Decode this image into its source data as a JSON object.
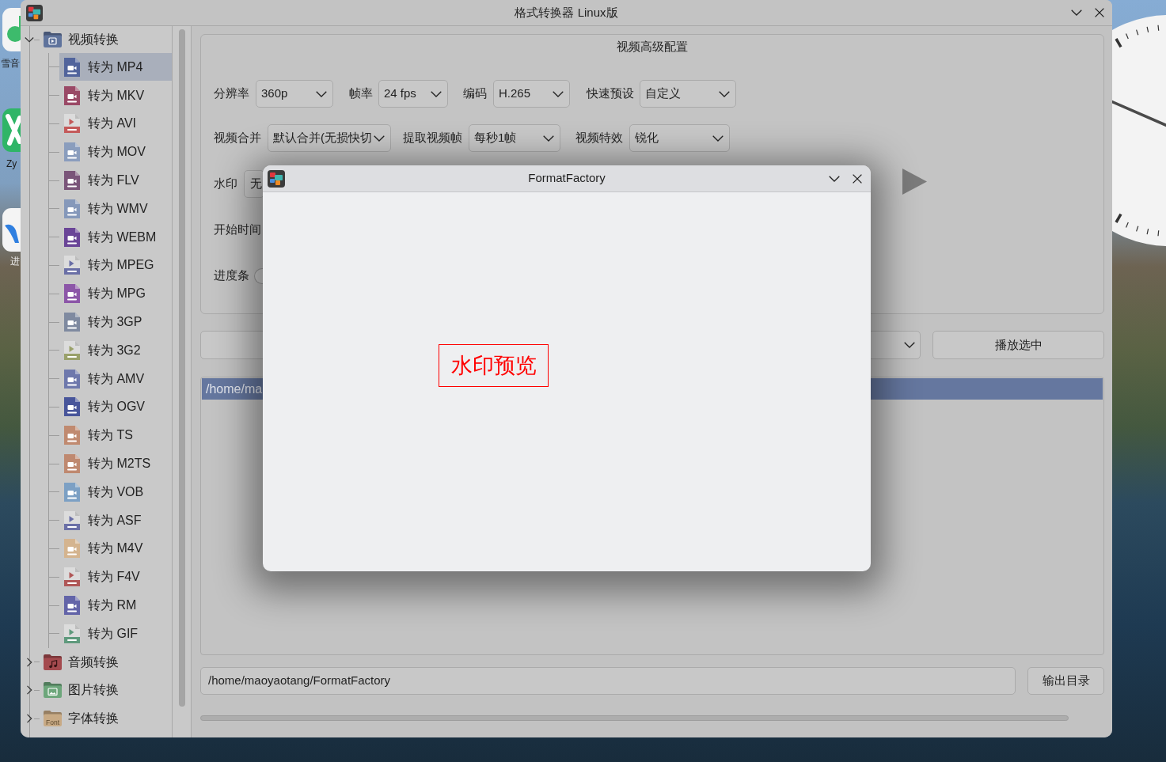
{
  "desktop": {
    "icons": [
      {
        "label": "雪音"
      },
      {
        "label": "Zy"
      },
      {
        "label": "进"
      }
    ]
  },
  "window": {
    "title": "格式转换器 Linux版"
  },
  "sidebar": {
    "items": [
      {
        "label": "视频转换",
        "kind": "video",
        "color": "#5f739c",
        "expanded": true,
        "children": [
          {
            "label": "转为 MP4",
            "kind": "solid",
            "color": "#51649c",
            "selected": true
          },
          {
            "label": "转为 MKV",
            "kind": "solid",
            "color": "#9a4966",
            "selected": false
          },
          {
            "label": "转为 AVI",
            "kind": "light",
            "color": "#c45a5a",
            "selected": false
          },
          {
            "label": "转为 MOV",
            "kind": "solid",
            "color": "#8a9dbd",
            "selected": false
          },
          {
            "label": "转为 FLV",
            "kind": "solid",
            "color": "#7a5579",
            "selected": false
          },
          {
            "label": "转为 WMV",
            "kind": "solid",
            "color": "#8598ba",
            "selected": false
          },
          {
            "label": "转为 WEBM",
            "kind": "solid",
            "color": "#6a4597",
            "selected": false
          },
          {
            "label": "转为 MPEG",
            "kind": "light",
            "color": "#6a6fa6",
            "selected": false
          },
          {
            "label": "转为 MPG",
            "kind": "solid",
            "color": "#8c56a8",
            "selected": false
          },
          {
            "label": "转为 3GP",
            "kind": "solid",
            "color": "#7f8aa0",
            "selected": false
          },
          {
            "label": "转为 3G2",
            "kind": "light",
            "color": "#9aa16b",
            "selected": false
          },
          {
            "label": "转为 AMV",
            "kind": "solid",
            "color": "#6e78ac",
            "selected": false
          },
          {
            "label": "转为 OGV",
            "kind": "solid",
            "color": "#48559a",
            "selected": false
          },
          {
            "label": "转为 TS",
            "kind": "solid",
            "color": "#c08a70",
            "selected": false
          },
          {
            "label": "转为 M2TS",
            "kind": "solid",
            "color": "#bf8970",
            "selected": false
          },
          {
            "label": "转为 VOB",
            "kind": "solid",
            "color": "#7ca0c4",
            "selected": false
          },
          {
            "label": "转为 ASF",
            "kind": "light",
            "color": "#6b70a7",
            "selected": false
          },
          {
            "label": "转为 M4V",
            "kind": "solid",
            "color": "#d4b48f",
            "selected": false
          },
          {
            "label": "转为 F4V",
            "kind": "light",
            "color": "#b05858",
            "selected": false
          },
          {
            "label": "转为 RM",
            "kind": "solid",
            "color": "#6364a8",
            "selected": false
          },
          {
            "label": "转为 GIF",
            "kind": "light",
            "color": "#5f9a7d",
            "selected": false
          }
        ]
      },
      {
        "label": "音频转换",
        "kind": "audio",
        "color": "#a44a4e",
        "expanded": false
      },
      {
        "label": "图片转换",
        "kind": "image",
        "color": "#6da67b",
        "expanded": false
      },
      {
        "label": "字体转换",
        "kind": "font",
        "color": "#c8aa85",
        "badge": "Font",
        "expanded": false
      }
    ]
  },
  "config": {
    "title": "视频高级配置",
    "fields": [
      {
        "label": "分辨率",
        "value": "360p"
      },
      {
        "label": "帧率",
        "value": "24 fps"
      },
      {
        "label": "编码",
        "value": "H.265"
      },
      {
        "label": "快速预设",
        "value": "自定义"
      },
      {
        "label": "视频合并",
        "value": "默认合并(无损快切"
      },
      {
        "label": "提取视频帧",
        "value": "每秒1帧"
      },
      {
        "label": "视频特效",
        "value": "锐化"
      }
    ],
    "watermark": {
      "label": "水印",
      "value": "无"
    },
    "start_time": {
      "label": "开始时间"
    },
    "progress": {
      "label": "进度条"
    }
  },
  "player": {
    "button": "播放选中"
  },
  "file_list": {
    "rows": [
      {
        "text": "/home/ma",
        "selected": true
      }
    ]
  },
  "output": {
    "path": "/home/maoyaotang/FormatFactory",
    "button": "输出目录"
  },
  "dialog": {
    "title": "FormatFactory",
    "preview_text": "水印预览"
  }
}
